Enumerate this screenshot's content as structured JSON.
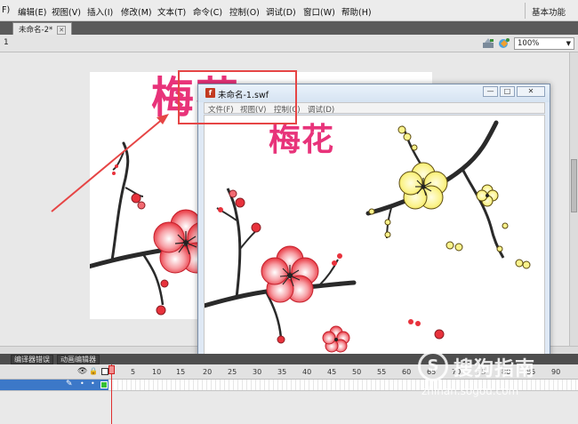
{
  "menubar": {
    "items": [
      "F)",
      "编辑(E)",
      "视图(V)",
      "插入(I)",
      "修改(M)",
      "文本(T)",
      "命令(C)",
      "控制(O)",
      "调试(D)",
      "窗口(W)",
      "帮助(H)"
    ],
    "workspace": "基本功能"
  },
  "document_tab": {
    "name": "未命名-2*"
  },
  "editbar": {
    "scene": "1",
    "zoom": "100%"
  },
  "stage": {
    "title": "梅花"
  },
  "swf_window": {
    "title": "未命名-1.swf",
    "menu": [
      "文件(F)",
      "视图(V)",
      "控制(C)",
      "调试(D)"
    ],
    "heading": "梅花"
  },
  "timeline": {
    "panel_tabs": [
      "编译器错误",
      "动画编辑器"
    ],
    "ruler": [
      "1",
      "5",
      "10",
      "15",
      "20",
      "25",
      "30",
      "35",
      "40",
      "45",
      "50",
      "55",
      "60",
      "65",
      "70",
      "75",
      "80",
      "85",
      "90"
    ]
  },
  "watermark": {
    "name": "搜狗指南",
    "url": "zhinan.sogou.com"
  },
  "colors": {
    "title_pink": "#e8337a",
    "annotation_red": "#e64545",
    "blossom_red": "#e8323c",
    "blossom_yellow": "#f7ec6a"
  }
}
